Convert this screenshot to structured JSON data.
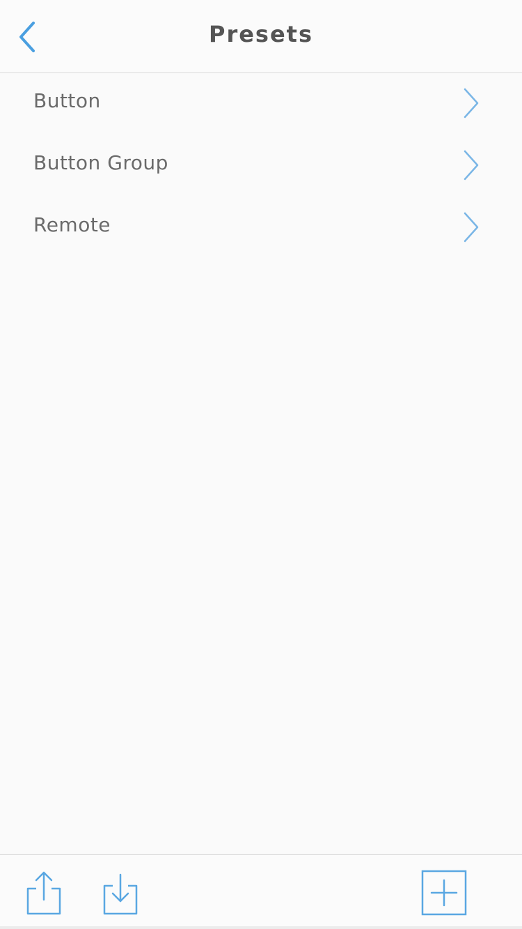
{
  "nav": {
    "title": "Presets",
    "back_icon": "chevron-left-icon"
  },
  "presets": {
    "items": [
      {
        "label": "Button",
        "icon": "chevron-right-icon"
      },
      {
        "label": "Button Group",
        "icon": "chevron-right-icon"
      },
      {
        "label": "Remote",
        "icon": "chevron-right-icon"
      }
    ]
  },
  "toolbar": {
    "share_icon": "share-icon",
    "import_icon": "import-icon",
    "add_icon": "add-icon"
  },
  "colors": {
    "accent": "#4a9fe0",
    "text": "#6a6a6a",
    "title": "#555555",
    "background": "#fafafa"
  }
}
